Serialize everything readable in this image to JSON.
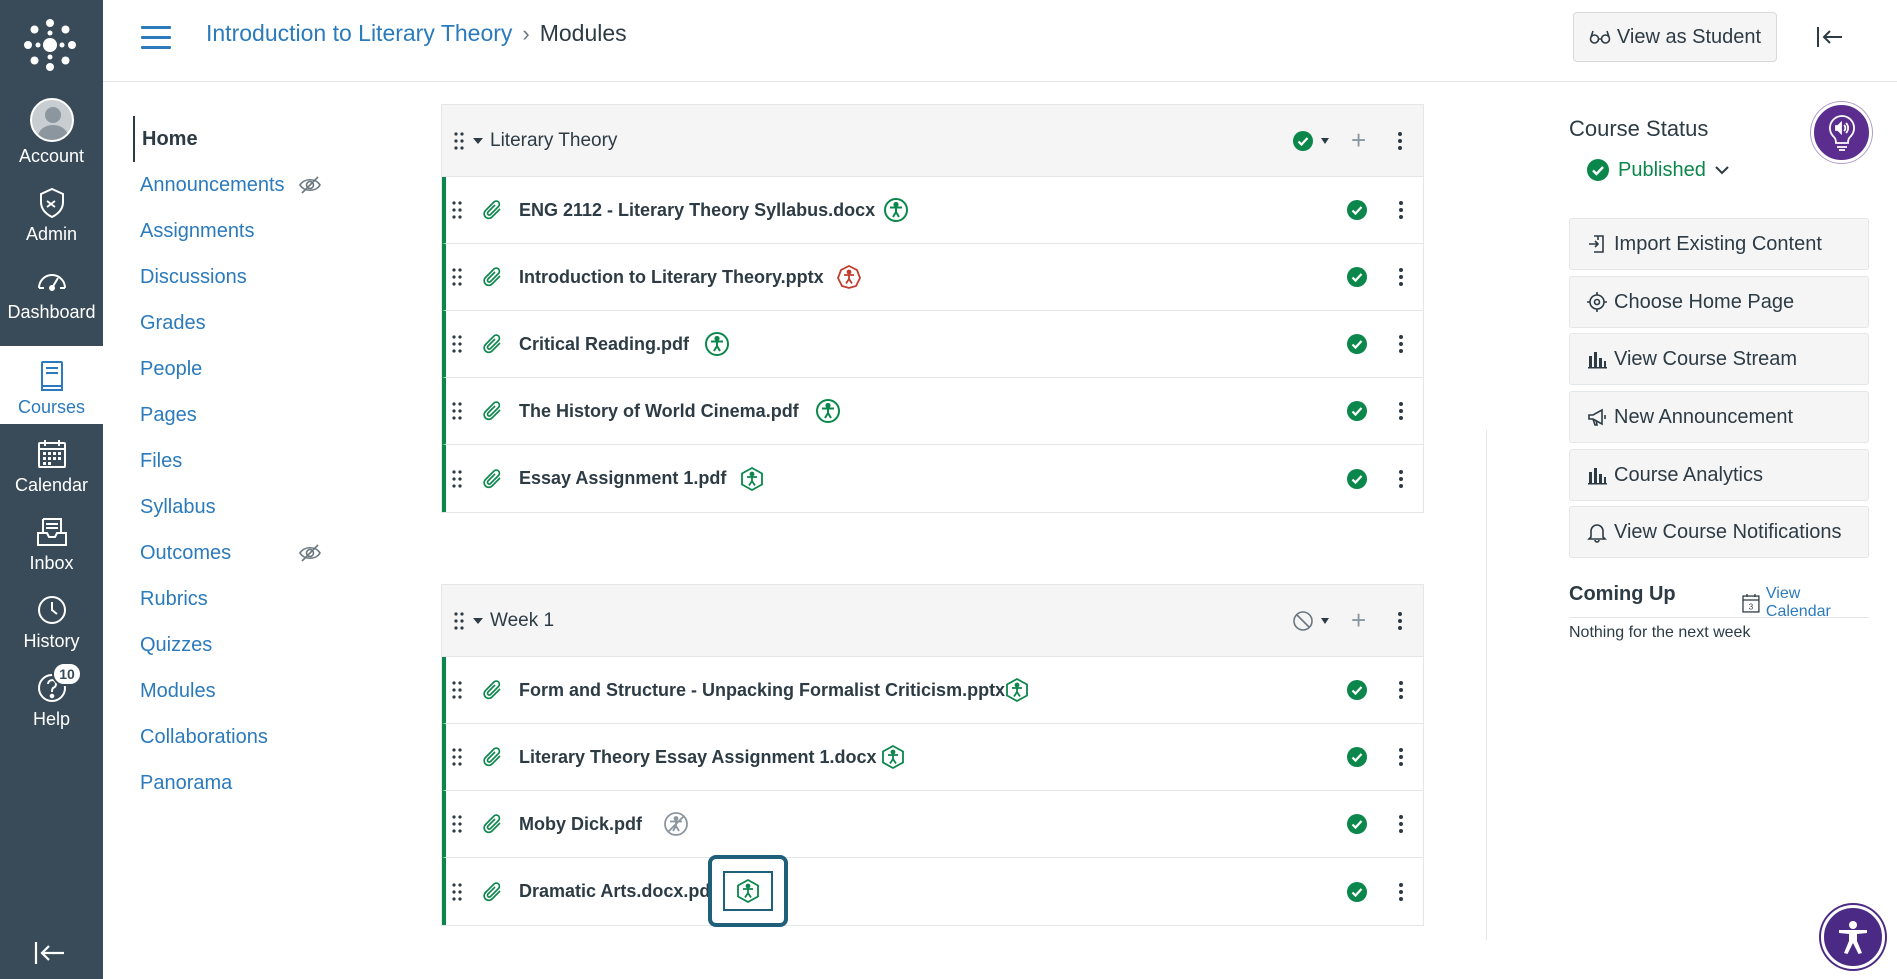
{
  "global_nav": {
    "items": [
      {
        "label": "Account",
        "icon": "avatar"
      },
      {
        "label": "Admin",
        "icon": "shield-icon"
      },
      {
        "label": "Dashboard",
        "icon": "dashboard-icon"
      },
      {
        "label": "Courses",
        "icon": "courses-icon"
      },
      {
        "label": "Calendar",
        "icon": "calendar-icon"
      },
      {
        "label": "Inbox",
        "icon": "inbox-icon"
      },
      {
        "label": "History",
        "icon": "clock-icon"
      },
      {
        "label": "Help",
        "icon": "help-icon"
      }
    ],
    "help_badge": "10",
    "active": "Courses"
  },
  "breadcrumb": {
    "course": "Introduction to Literary Theory",
    "separator": "›",
    "current": "Modules"
  },
  "header": {
    "view_as_student": "View as Student"
  },
  "course_nav": {
    "items": [
      {
        "label": "Home"
      },
      {
        "label": "Announcements"
      },
      {
        "label": "Assignments"
      },
      {
        "label": "Discussions"
      },
      {
        "label": "Grades"
      },
      {
        "label": "People"
      },
      {
        "label": "Pages"
      },
      {
        "label": "Files"
      },
      {
        "label": "Syllabus"
      },
      {
        "label": "Outcomes"
      },
      {
        "label": "Rubrics"
      },
      {
        "label": "Quizzes"
      },
      {
        "label": "Modules"
      },
      {
        "label": "Collaborations"
      },
      {
        "label": "Panorama"
      }
    ]
  },
  "modules": [
    {
      "title": "Literary Theory",
      "status": "published",
      "items": [
        {
          "title": "ENG 2112 - Literary Theory Syllabus.docx",
          "a11y": "good"
        },
        {
          "title": "Introduction to Literary Theory.pptx",
          "a11y": "bad"
        },
        {
          "title": "Critical Reading.pdf",
          "a11y": "good"
        },
        {
          "title": "The History of World Cinema.pdf",
          "a11y": "good"
        },
        {
          "title": "Essay Assignment 1.pdf",
          "a11y": "hex"
        }
      ]
    },
    {
      "title": "Week 1",
      "status": "unpublished",
      "items": [
        {
          "title": "Form and Structure - Unpacking Formalist Criticism.pptx",
          "a11y": "hex"
        },
        {
          "title": "Literary Theory Essay Assignment 1.docx",
          "a11y": "hex"
        },
        {
          "title": "Moby Dick.pdf",
          "a11y": "none"
        },
        {
          "title": "Dramatic Arts.docx.pdf",
          "a11y": "hex-focused"
        }
      ]
    }
  ],
  "aside": {
    "course_status_title": "Course Status",
    "published_label": "Published",
    "buttons": [
      {
        "label": "Import Existing Content",
        "icon": "import-icon"
      },
      {
        "label": "Choose Home Page",
        "icon": "target-icon"
      },
      {
        "label": "View Course Stream",
        "icon": "bar-chart-icon"
      },
      {
        "label": "New Announcement",
        "icon": "megaphone-icon"
      },
      {
        "label": "Course Analytics",
        "icon": "bar-chart-icon"
      },
      {
        "label": "View Course Notifications",
        "icon": "bell-icon"
      }
    ],
    "coming_up_title": "Coming Up",
    "view_calendar": "View Calendar",
    "calendar_day": "3",
    "coming_up_empty": "Nothing for the next week"
  },
  "colors": {
    "nav_bg": "#394b58",
    "link": "#2b7abc",
    "success": "#0b874b",
    "danger": "#c23c2d",
    "ally_purple": "#5b2d8e"
  }
}
